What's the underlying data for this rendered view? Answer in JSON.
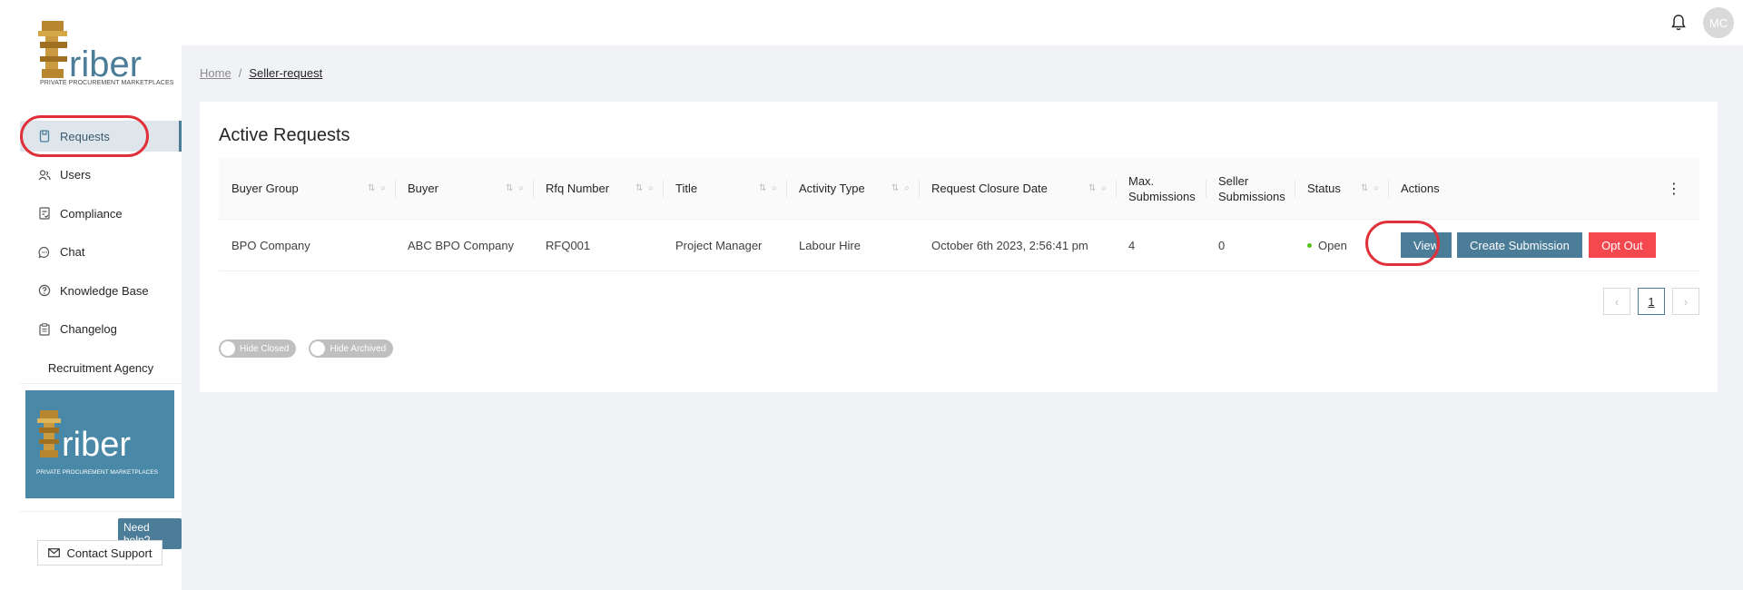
{
  "brand": {
    "logo_text": "riber",
    "logo_letter": "T",
    "tagline": "PRIVATE PROCUREMENT MARKETPLACES",
    "colors": {
      "accent": "#4b7c98",
      "danger": "#f5474e",
      "status_open": "#52c41a",
      "agency_logo_bg": "#4988a6"
    }
  },
  "header": {
    "notification_icon": "bell-icon",
    "avatar_initials": "MC"
  },
  "sidebar": {
    "items": [
      {
        "label": "Requests",
        "icon": "file-icon",
        "active": true
      },
      {
        "label": "Users",
        "icon": "users-icon",
        "active": false
      },
      {
        "label": "Compliance",
        "icon": "compliance-icon",
        "active": false
      },
      {
        "label": "Chat",
        "icon": "chat-icon",
        "active": false
      },
      {
        "label": "Knowledge Base",
        "icon": "question-icon",
        "active": false
      },
      {
        "label": "Changelog",
        "icon": "changelog-icon",
        "active": false
      }
    ],
    "agency_label": "Recruitment Agency",
    "need_help": "Need help?",
    "contact_support": "Contact Support"
  },
  "breadcrumb": {
    "home": "Home",
    "separator": "/",
    "current": "Seller-request"
  },
  "card": {
    "title": "Active Requests",
    "columns": [
      {
        "label": "Buyer Group"
      },
      {
        "label": "Buyer"
      },
      {
        "label": "Rfq Number"
      },
      {
        "label": "Title"
      },
      {
        "label": "Activity Type"
      },
      {
        "label": "Request Closure Date"
      },
      {
        "label": "Max.",
        "label2": "Submissions"
      },
      {
        "label": "Seller",
        "label2": "Submissions"
      },
      {
        "label": "Status"
      },
      {
        "label": "Actions"
      }
    ],
    "rows": [
      {
        "buyer_group": "BPO Company",
        "buyer": "ABC BPO Company",
        "rfq_number": "RFQ001",
        "title": "Project Manager",
        "activity_type": "Labour Hire",
        "closure_date": "October 6th 2023, 2:56:41 pm",
        "max_submissions": "4",
        "seller_submissions": "0",
        "status": "Open",
        "actions": {
          "view": "View",
          "create": "Create Submission",
          "opt_out": "Opt Out"
        }
      }
    ],
    "pagination": {
      "prev": "‹",
      "page": "1",
      "next": "›"
    },
    "toggles": {
      "hide_closed": "Hide Closed",
      "hide_archived": "Hide Archived"
    }
  }
}
